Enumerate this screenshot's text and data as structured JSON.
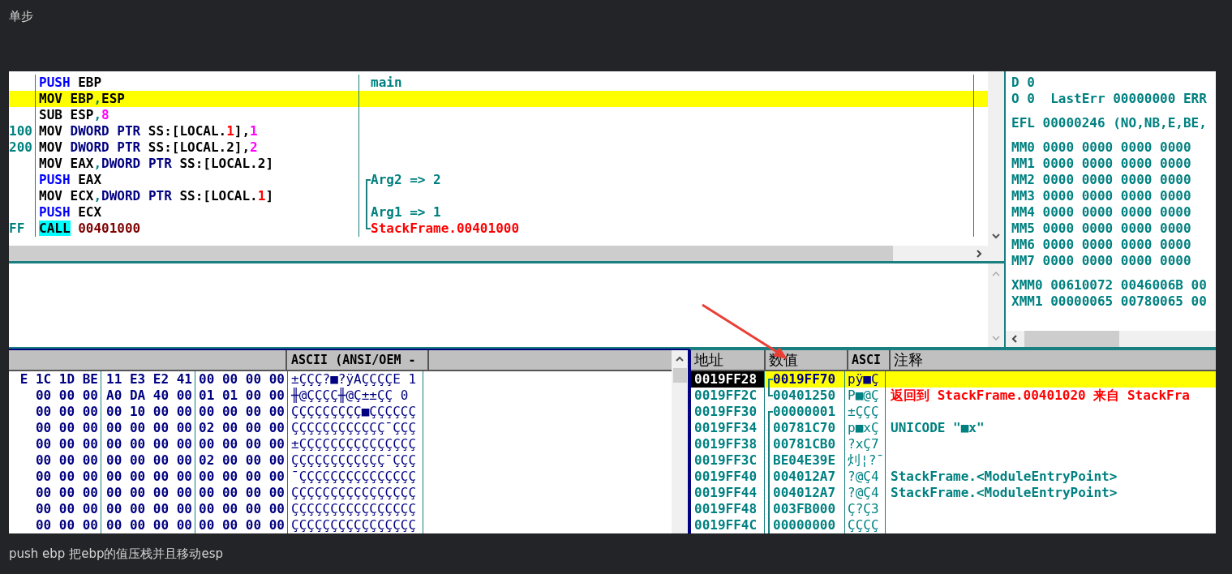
{
  "page_title": "单步",
  "disassembly": {
    "lines": [
      {
        "selected": false,
        "segments": [
          {
            "kind": "op",
            "text": "PUSH"
          },
          {
            "kind": "text",
            "text": " EBP"
          }
        ],
        "comment": {
          "text": "main",
          "kind": "info"
        }
      },
      {
        "selected": true,
        "segments": [
          {
            "kind": "text",
            "text": "MOV EBP"
          },
          {
            "kind": "sep",
            "text": ","
          },
          {
            "kind": "text",
            "text": "ESP"
          }
        ]
      },
      {
        "selected": false,
        "segments": [
          {
            "kind": "text",
            "text": "SUB ESP"
          },
          {
            "kind": "sep",
            "text": ","
          },
          {
            "kind": "imm",
            "text": "8"
          }
        ]
      },
      {
        "hex": "100",
        "selected": false,
        "segments": [
          {
            "kind": "text",
            "text": "MOV "
          },
          {
            "kind": "ptr",
            "text": "DWORD PTR"
          },
          {
            "kind": "text",
            "text": " SS:[LOCAL."
          },
          {
            "kind": "idx",
            "text": "1"
          },
          {
            "kind": "text",
            "text": "],"
          },
          {
            "kind": "imm",
            "text": "1"
          }
        ]
      },
      {
        "hex": "200",
        "selected": false,
        "segments": [
          {
            "kind": "text",
            "text": "MOV "
          },
          {
            "kind": "ptr",
            "text": "DWORD PTR"
          },
          {
            "kind": "text",
            "text": " SS:[LOCAL.2],"
          },
          {
            "kind": "imm",
            "text": "2"
          }
        ]
      },
      {
        "selected": false,
        "segments": [
          {
            "kind": "text",
            "text": "MOV EAX"
          },
          {
            "kind": "sep",
            "text": ","
          },
          {
            "kind": "ptr",
            "text": "DWORD PTR"
          },
          {
            "kind": "text",
            "text": " SS:[LOCAL.2]"
          }
        ]
      },
      {
        "selected": false,
        "segments": [
          {
            "kind": "op",
            "text": "PUSH"
          },
          {
            "kind": "text",
            "text": " EAX"
          }
        ],
        "comment": {
          "text": "Arg2 => 2",
          "kind": "info",
          "bracket": {
            "kind": "start"
          }
        }
      },
      {
        "selected": false,
        "segments": [
          {
            "kind": "text",
            "text": "MOV ECX"
          },
          {
            "kind": "sep",
            "text": ","
          },
          {
            "kind": "ptr",
            "text": "DWORD PTR"
          },
          {
            "kind": "text",
            "text": " SS:[LOCAL."
          },
          {
            "kind": "idx",
            "text": "1"
          },
          {
            "kind": "text",
            "text": "]"
          }
        ],
        "comment": {
          "bracket": {
            "kind": "mid"
          }
        }
      },
      {
        "selected": false,
        "segments": [
          {
            "kind": "op",
            "text": "PUSH"
          },
          {
            "kind": "text",
            "text": " ECX"
          }
        ],
        "comment": {
          "text": "Arg1 => 1",
          "kind": "info",
          "bracket": {
            "kind": "mid"
          }
        }
      },
      {
        "hex": "FF",
        "selected": false,
        "segments": [
          {
            "kind": "call",
            "text": "CALL"
          },
          {
            "kind": "addr",
            "text": " 00401000"
          }
        ],
        "comment": {
          "text": "StackFrame.00401000",
          "kind": "call",
          "bracket": {
            "kind": "end"
          }
        }
      }
    ]
  },
  "register_groups": [
    [
      "D 0",
      "O 0  LastErr 00000000 ERR"
    ],
    [
      "EFL 00000246 (NO,NB,E,BE,"
    ],
    [
      "MM0 0000 0000 0000 0000",
      "MM1 0000 0000 0000 0000",
      "MM2 0000 0000 0000 0000",
      "MM3 0000 0000 0000 0000",
      "MM4 0000 0000 0000 0000",
      "MM5 0000 0000 0000 0000",
      "MM6 0000 0000 0000 0000",
      "MM7 0000 0000 0000 0000"
    ],
    [
      "XMM0 00610072 0046006B 00",
      "XMM1 00000065 00780065 00"
    ]
  ],
  "dump": {
    "ascii_header": "ASCII (ANSI/OEM -",
    "rows": [
      {
        "hex": [
          "E 1C 1D BE",
          "11 E3 E2 41",
          "00 00 00 00"
        ],
        "ascii": "±ÇÇÇ?■?ÿAÇÇÇÇE 1"
      },
      {
        "hex": [
          "00 00 00",
          "A0 DA 40 00",
          "01 01 00 00"
        ],
        "ascii": "╫@ÇÇÇÇ╫@Ç±±ÇÇ 0"
      },
      {
        "hex": [
          "00 00 00",
          "00 10 00 00",
          "00 00 00 00"
        ],
        "ascii": "ÇÇÇÇÇÇÇÇÇ■ÇÇÇÇÇÇ"
      },
      {
        "hex": [
          "00 00 00",
          "00 00 00 00",
          "02 00 00 00"
        ],
        "ascii": "ÇÇÇÇÇÇÇÇÇÇÇÇ¯ÇÇÇ"
      },
      {
        "hex": [
          "00 00 00",
          "00 00 00 00",
          "00 00 00 00"
        ],
        "ascii": "±ÇÇÇÇÇÇÇÇÇÇÇÇÇÇÇ"
      },
      {
        "hex": [
          "00 00 00",
          "00 00 00 00",
          "02 00 00 00"
        ],
        "ascii": "ÇÇÇÇÇÇÇÇÇÇÇÇ¯ÇÇÇ"
      },
      {
        "hex": [
          "00 00 00",
          "00 00 00 00",
          "00 00 00 00"
        ],
        "ascii": "¯ÇÇÇÇÇÇÇÇÇÇÇÇÇÇÇ"
      },
      {
        "hex": [
          "00 00 00",
          "00 00 00 00",
          "00 00 00 00"
        ],
        "ascii": "ÇÇÇÇÇÇÇÇÇÇÇÇÇÇÇÇ"
      },
      {
        "hex": [
          "00 00 00",
          "00 00 00 00",
          "00 00 00 00"
        ],
        "ascii": "ÇÇÇÇÇÇÇÇÇÇÇÇÇÇÇÇ"
      },
      {
        "hex": [
          "00 00 00",
          "00 00 00 00",
          "00 00 00 00"
        ],
        "ascii": "ÇÇÇÇÇÇÇÇÇÇÇÇÇÇÇÇ"
      }
    ]
  },
  "stack": {
    "columns": [
      "地址",
      "数值",
      "ASCI",
      "注释"
    ],
    "rows": [
      {
        "address": "0019FF28",
        "value": "0019FF70",
        "ascii": "pÿ■Ç",
        "selected": true,
        "bracket": {
          "kind": "start"
        }
      },
      {
        "address": "0019FF2C",
        "value": "00401250",
        "ascii": "P■@Ç",
        "selected": false,
        "bracket": {
          "kind": "end"
        },
        "comment": {
          "text": "返回到 StackFrame.00401020 来自 StackFra",
          "kind": "call"
        }
      },
      {
        "address": "0019FF30",
        "value": "00000001",
        "ascii": "±ÇÇÇ",
        "selected": false,
        "bracket": {
          "kind": "start"
        }
      },
      {
        "address": "0019FF34",
        "value": "00781C70",
        "ascii": "p■xÇ",
        "selected": false,
        "bracket": {
          "kind": "mid"
        },
        "comment": {
          "text": "UNICODE \"■x\"",
          "kind": "info"
        }
      },
      {
        "address": "0019FF38",
        "value": "00781CB0",
        "ascii": "?xÇ7",
        "selected": false,
        "bracket": {
          "kind": "mid"
        }
      },
      {
        "address": "0019FF3C",
        "value": "BE04E39E",
        "ascii": "灲¦?¯",
        "selected": false,
        "bracket": {
          "kind": "mid"
        }
      },
      {
        "address": "0019FF40",
        "value": "004012A7",
        "ascii": "?@Ç4",
        "selected": false,
        "bracket": {
          "kind": "mid"
        },
        "comment": {
          "text": "StackFrame.<ModuleEntryPoint>",
          "kind": "info"
        }
      },
      {
        "address": "0019FF44",
        "value": "004012A7",
        "ascii": "?@Ç4",
        "selected": false,
        "bracket": {
          "kind": "mid"
        },
        "comment": {
          "text": "StackFrame.<ModuleEntryPoint>",
          "kind": "info"
        }
      },
      {
        "address": "0019FF48",
        "value": "003FB000",
        "ascii": "Ç?Ç3",
        "selected": false,
        "bracket": {
          "kind": "mid"
        }
      },
      {
        "address": "0019FF4C",
        "value": "00000000",
        "ascii": "ÇÇÇÇ",
        "selected": false,
        "bracket": {
          "kind": "mid"
        }
      }
    ]
  },
  "caption": "push ebp 把ebp的值压栈并且移动esp"
}
